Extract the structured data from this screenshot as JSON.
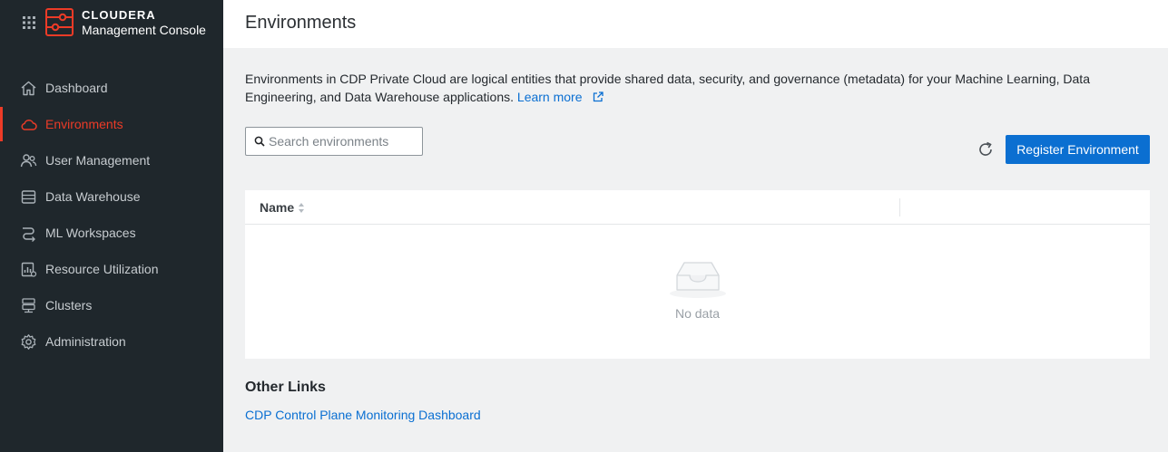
{
  "brand": {
    "name": "CLOUDERA",
    "product": "Management Console"
  },
  "sidebar": {
    "items": [
      {
        "label": "Dashboard",
        "icon": "home-icon",
        "active": false
      },
      {
        "label": "Environments",
        "icon": "cloud-icon",
        "active": true
      },
      {
        "label": "User Management",
        "icon": "users-icon",
        "active": false
      },
      {
        "label": "Data Warehouse",
        "icon": "database-icon",
        "active": false
      },
      {
        "label": "ML Workspaces",
        "icon": "ml-icon",
        "active": false
      },
      {
        "label": "Resource Utilization",
        "icon": "chart-icon",
        "active": false
      },
      {
        "label": "Clusters",
        "icon": "server-icon",
        "active": false
      },
      {
        "label": "Administration",
        "icon": "gear-icon",
        "active": false
      }
    ]
  },
  "header": {
    "title": "Environments"
  },
  "intro": {
    "text": "Environments in CDP Private Cloud are logical entities that provide shared data, security, and governance (metadata) for your Machine Learning, Data Engineering, and Data Warehouse applications.",
    "learn_more": "Learn more"
  },
  "search": {
    "placeholder": "Search environments",
    "value": ""
  },
  "toolbar": {
    "register_label": "Register Environment"
  },
  "table": {
    "columns": [
      "Name",
      ""
    ],
    "empty_text": "No data"
  },
  "other_links": {
    "title": "Other Links",
    "links": [
      "CDP Control Plane Monitoring Dashboard"
    ]
  },
  "colors": {
    "accent": "#ec3b27",
    "primary": "#0b6fd1",
    "sidebar_bg": "#1f272c",
    "link": "#0a6fd2"
  }
}
